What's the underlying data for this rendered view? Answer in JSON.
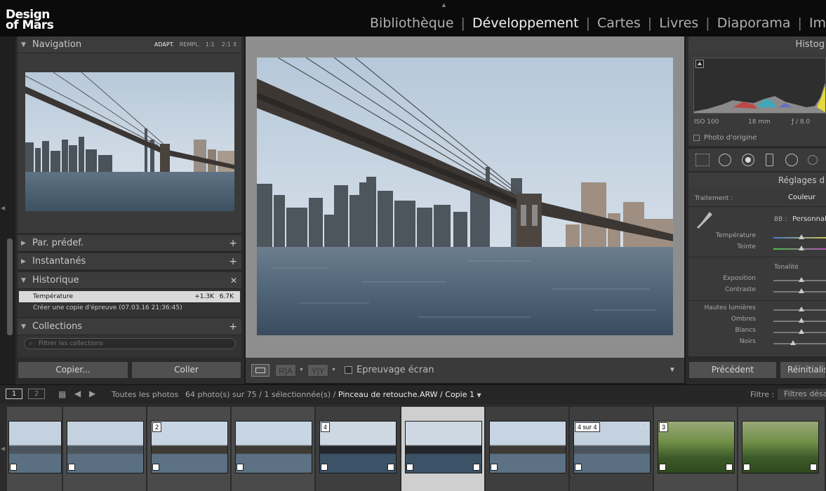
{
  "app": {
    "logo_line1": "Design",
    "logo_line2": "of Mars"
  },
  "modules": [
    {
      "label": "Bibliothèque",
      "active": false
    },
    {
      "label": "Développement",
      "active": true
    },
    {
      "label": "Cartes",
      "active": false
    },
    {
      "label": "Livres",
      "active": false
    },
    {
      "label": "Diaporama",
      "active": false
    },
    {
      "label": "Impressio",
      "active": false
    }
  ],
  "navigator": {
    "title": "Navigation",
    "zoom_options": [
      "ADAPT.",
      "REMPL.",
      "1:1",
      "2:1"
    ]
  },
  "left_panel": {
    "presets": "Par. prédef.",
    "snapshots": "Instantanés",
    "history": "Historique",
    "history_items": [
      {
        "label": "Température",
        "before": "+1.3K",
        "after": "6.7K",
        "selected": true
      },
      {
        "label": "Créer une copie d'épreuve (07.03.16 21:36:45)",
        "before": "",
        "after": "",
        "selected": false
      }
    ],
    "collections": "Collections",
    "filter_placeholder": "Filtrer les collections",
    "copy_button": "Copier...",
    "paste_button": "Coller"
  },
  "center_toolbar": {
    "proof_label": "Epreuvage écran"
  },
  "right_panel": {
    "histogram_title": "Histog",
    "iso": "ISO 100",
    "focal": "18 mm",
    "aperture": "ƒ / 8.0",
    "original_photo": "Photo d'origine",
    "basic_title": "Réglages d",
    "treatment_label": "Traitement :",
    "treatment_value": "Couleur",
    "wb_label": "BB :",
    "wb_value": "Personnali",
    "tone_label": "Tonalité",
    "sliders": [
      {
        "name": "Température",
        "value": 0.5
      },
      {
        "name": "Teinte",
        "value": 0.5
      },
      {
        "name": "Exposition",
        "value": 0.5
      },
      {
        "name": "Contraste",
        "value": 0.5
      },
      {
        "name": "Hautes lumières",
        "value": 0.5
      },
      {
        "name": "Ombres",
        "value": 0.5
      },
      {
        "name": "Blancs",
        "value": 0.5
      },
      {
        "name": "Noirs",
        "value": 0.35
      }
    ],
    "previous_button": "Précédent",
    "reset_button": "Réinitialise"
  },
  "filmstrip_bar": {
    "page1": "1",
    "page2": "2",
    "source": "Toutes les photos",
    "count": "64 photo(s) sur 75 / 1 sélectionnée(s) /",
    "filename": "Pinceau de retouche.ARW / Copie 1",
    "filter_label": "Filtre :",
    "filter_value": "Filtres désac"
  },
  "filmstrip": [
    {
      "badge": "",
      "type": "city"
    },
    {
      "badge": "",
      "type": "city"
    },
    {
      "badge": "2",
      "type": "bridge"
    },
    {
      "badge": "",
      "type": "bridge"
    },
    {
      "badge": "4",
      "type": "bridge-dark"
    },
    {
      "badge": "",
      "type": "bridge-dark"
    },
    {
      "badge": "",
      "type": "bridge"
    },
    {
      "badge": "4 sur 4",
      "type": "city"
    },
    {
      "badge": "3",
      "type": "park"
    },
    {
      "badge": "",
      "type": "park"
    }
  ]
}
